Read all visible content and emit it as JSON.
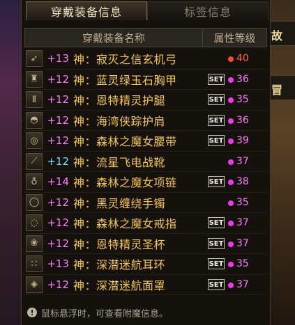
{
  "tabs": [
    {
      "label": "穿戴装备信息",
      "active": true
    },
    {
      "label": "标签信息",
      "active": false
    }
  ],
  "table": {
    "col_name": "穿戴装备名称",
    "col_level": "属性等级"
  },
  "side": {
    "right_label_1": "故",
    "right_label_2": "冒"
  },
  "items": [
    {
      "enh": "+13",
      "enh_color": "pink",
      "name": "神：寂灭之信玄机弓",
      "badge": "",
      "dot": "red",
      "level": "40",
      "icon": "bow-icon"
    },
    {
      "enh": "+12",
      "enh_color": "pink",
      "name": "神：蓝灵绿玉石胸甲",
      "badge": "SET",
      "dot": "pink",
      "level": "36",
      "icon": "chest-armor-icon"
    },
    {
      "enh": "+12",
      "enh_color": "pink",
      "name": "神：恩特精灵护腿",
      "badge": "SET",
      "dot": "pink",
      "level": "35",
      "icon": "leg-armor-icon"
    },
    {
      "enh": "+12",
      "enh_color": "pink",
      "name": "神：海湾侠踪护肩",
      "badge": "SET",
      "dot": "pink",
      "level": "36",
      "icon": "shoulder-armor-icon"
    },
    {
      "enh": "+12",
      "enh_color": "pink",
      "name": "神：森林之魔女腰带",
      "badge": "SET",
      "dot": "pink",
      "level": "39",
      "icon": "belt-icon"
    },
    {
      "enh": "+12",
      "enh_color": "blue",
      "name": "神：流星飞电战靴",
      "badge": "",
      "dot": "pink",
      "level": "37",
      "icon": "boots-icon"
    },
    {
      "enh": "+14",
      "enh_color": "pink",
      "name": "神：森林之魔女项链",
      "badge": "SET",
      "dot": "pink",
      "level": "38",
      "icon": "necklace-icon"
    },
    {
      "enh": "+12",
      "enh_color": "pink",
      "name": "神：黑灵缠绕手镯",
      "badge": "",
      "dot": "pink",
      "level": "35",
      "icon": "bracelet-icon"
    },
    {
      "enh": "+12",
      "enh_color": "pink",
      "name": "神：森林之魔女戒指",
      "badge": "SET",
      "dot": "pink",
      "level": "37",
      "icon": "ring-icon"
    },
    {
      "enh": "+12",
      "enh_color": "pink",
      "name": "神：恩特精灵圣杯",
      "badge": "SET",
      "dot": "pink",
      "level": "37",
      "icon": "holy-cup-icon"
    },
    {
      "enh": "+13",
      "enh_color": "pink",
      "name": "神：深潜迷航耳环",
      "badge": "SET",
      "dot": "pink",
      "level": "35",
      "icon": "earring-icon"
    },
    {
      "enh": "+12",
      "enh_color": "pink",
      "name": "神：深潜迷航面罩",
      "badge": "SET",
      "dot": "pink",
      "level": "37",
      "icon": "mask-icon"
    }
  ],
  "footer": {
    "text": "鼠标悬浮时，可查看附魔信息。",
    "icon": "info-icon"
  }
}
